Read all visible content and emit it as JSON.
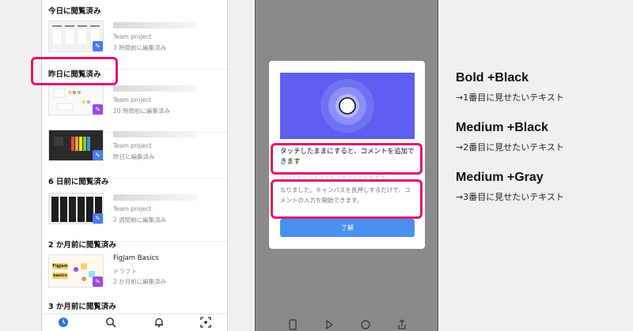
{
  "left_phone": {
    "sections": [
      {
        "title": "今日に閲覧済み"
      },
      {
        "title": "昨日に閲覧済み"
      },
      {
        "title": "6 日前に閲覧済み"
      },
      {
        "title": "2 か月前に閲覧済み"
      },
      {
        "title": "3 か月前に閲覧済み"
      }
    ],
    "files": [
      {
        "project": "Team project",
        "time": "3 時間前に編集済み",
        "badge_color": "#4a7bf0"
      },
      {
        "project": "Team project",
        "time": "20 時間前に編集済み",
        "badge_color": "#9b4ce8"
      },
      {
        "project": "Team project",
        "time": "昨日に編集済み",
        "badge_color": "#4a7bf0"
      },
      {
        "project": "Team project",
        "time": "2 週間前に編集済み",
        "badge_color": "#4a7bf0"
      },
      {
        "name": "FigJam Basics",
        "project": "ドラフト",
        "time": "2 か月前に編集済み",
        "badge_color": "#9b4ce8"
      }
    ],
    "thumb_labels": {
      "figjam": "FigJam",
      "basics": "basics"
    },
    "nav": [
      "clock-icon",
      "search-icon",
      "bell-icon",
      "scan-icon"
    ]
  },
  "right_phone": {
    "dialog": {
      "title": "タッチしたままにすると、コメントを追加できます",
      "body_obscured": "モバイルデバイスでもコメントできるように",
      "body": "なりました。キャンバスを長押しするだけで、コメントの入力を開始できます。",
      "ok_button": "了解"
    },
    "nav": [
      "file-icon",
      "play-icon",
      "comment-icon",
      "share-icon"
    ]
  },
  "legend": [
    {
      "heading": "Bold +Black",
      "description": "→1番目に見せたいテキスト"
    },
    {
      "heading": "Medium +Black",
      "description": "→2番目に見せたいテキスト"
    },
    {
      "heading": "Medium +Gray",
      "description": "→3番目に見せたいテキスト"
    }
  ],
  "colors": {
    "highlight": "#e0146e",
    "banner": "#5b5ef0",
    "ok_button": "#4a90ee",
    "overlay": "#8a8a8a"
  }
}
